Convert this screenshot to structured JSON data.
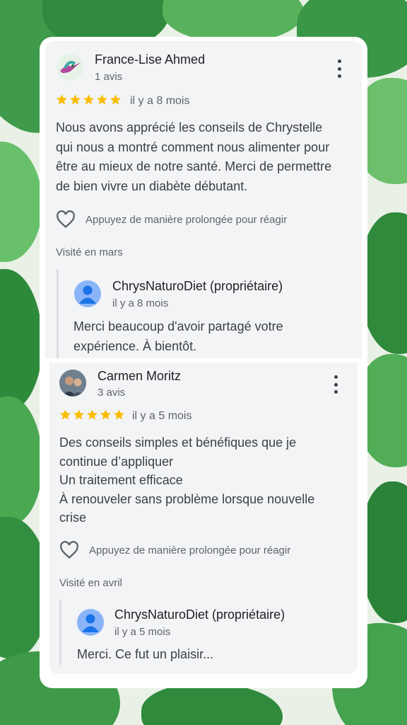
{
  "reviews": [
    {
      "reviewer_name": "France-Lise Ahmed",
      "review_count": "1 avis",
      "rating": 5,
      "date": "il y a 8 mois",
      "text_lines": [
        "Nous avons apprécié les conseils de Chrystelle",
        "qui nous a montré comment nous alimenter pour",
        "être au mieux de notre santé. Merci de permettre",
        "de bien vivre un diabète débutant."
      ],
      "react_label": "Appuyez de manière prolongée pour réagir",
      "visited": "Visité en mars",
      "owner_reply": {
        "name": "ChrysNaturoDiet (propriétaire)",
        "date": "il y a 8 mois",
        "text_lines": [
          "Merci beaucoup d'avoir partagé votre",
          "expérience. À bientôt."
        ]
      }
    },
    {
      "reviewer_name": "Carmen Moritz",
      "review_count": "3 avis",
      "rating": 5,
      "date": "il y a 5 mois",
      "text_lines": [
        "Des conseils simples et bénéfiques que je",
        "continue d’appliquer",
        "Un traitement efficace",
        "À renouveler sans problème lorsque nouvelle",
        "crise"
      ],
      "react_label": "Appuyez de manière prolongée pour réagir",
      "visited": "Visité en avril",
      "owner_reply": {
        "name": "ChrysNaturoDiet (propriétaire)",
        "date": "il y a 5 mois",
        "text_lines": [
          "Merci. Ce fut un plaisir..."
        ]
      }
    }
  ],
  "colors": {
    "star": "#fbbc04",
    "owner_avatar": "#8ab4f8",
    "card_bg": "#f3f4f6"
  }
}
